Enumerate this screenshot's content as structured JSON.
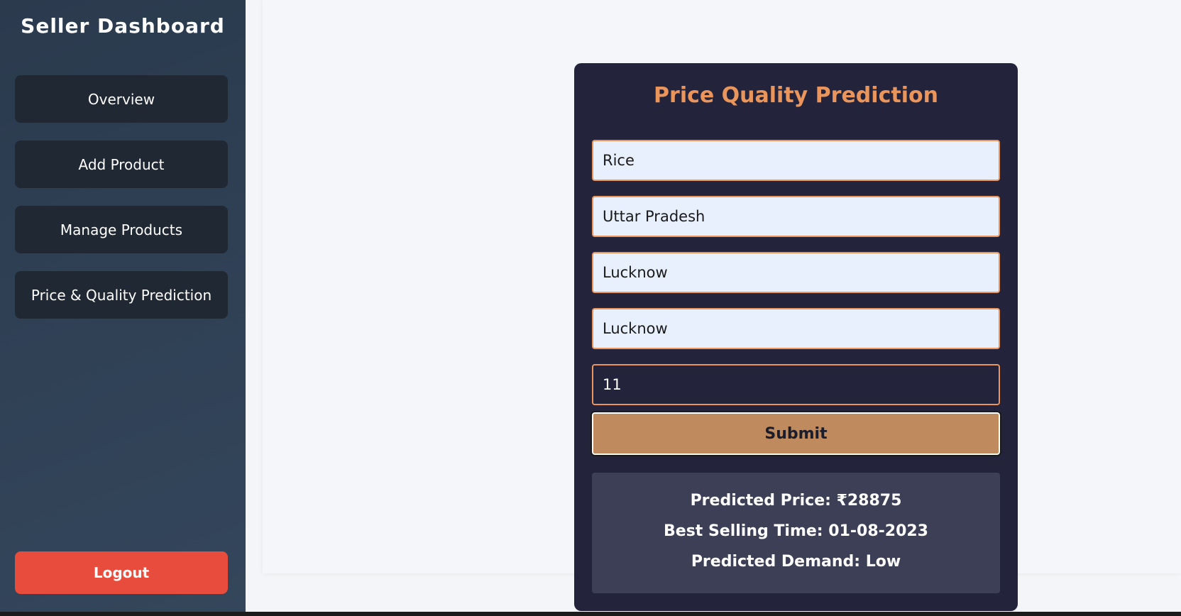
{
  "sidebar": {
    "title": "Seller Dashboard",
    "items": [
      {
        "label": "Overview"
      },
      {
        "label": "Add Product"
      },
      {
        "label": "Manage Products"
      },
      {
        "label": "Price & Quality Prediction"
      }
    ],
    "logout_label": "Logout"
  },
  "card": {
    "title": "Price Quality Prediction",
    "fields": [
      {
        "value": "Rice"
      },
      {
        "value": "Uttar Pradesh"
      },
      {
        "value": "Lucknow"
      },
      {
        "value": "Lucknow"
      },
      {
        "value": "11"
      }
    ],
    "submit_label": "Submit",
    "results": {
      "price": "Predicted Price: ₹28875",
      "best_time": "Best Selling Time: 01-08-2023",
      "demand": "Predicted Demand: Low"
    }
  },
  "colors": {
    "accent": "#e9955b",
    "submit": "#bf8a5e",
    "logout": "#e74c3c",
    "card_bg": "#23243b",
    "nav_bg": "#1f2833"
  }
}
